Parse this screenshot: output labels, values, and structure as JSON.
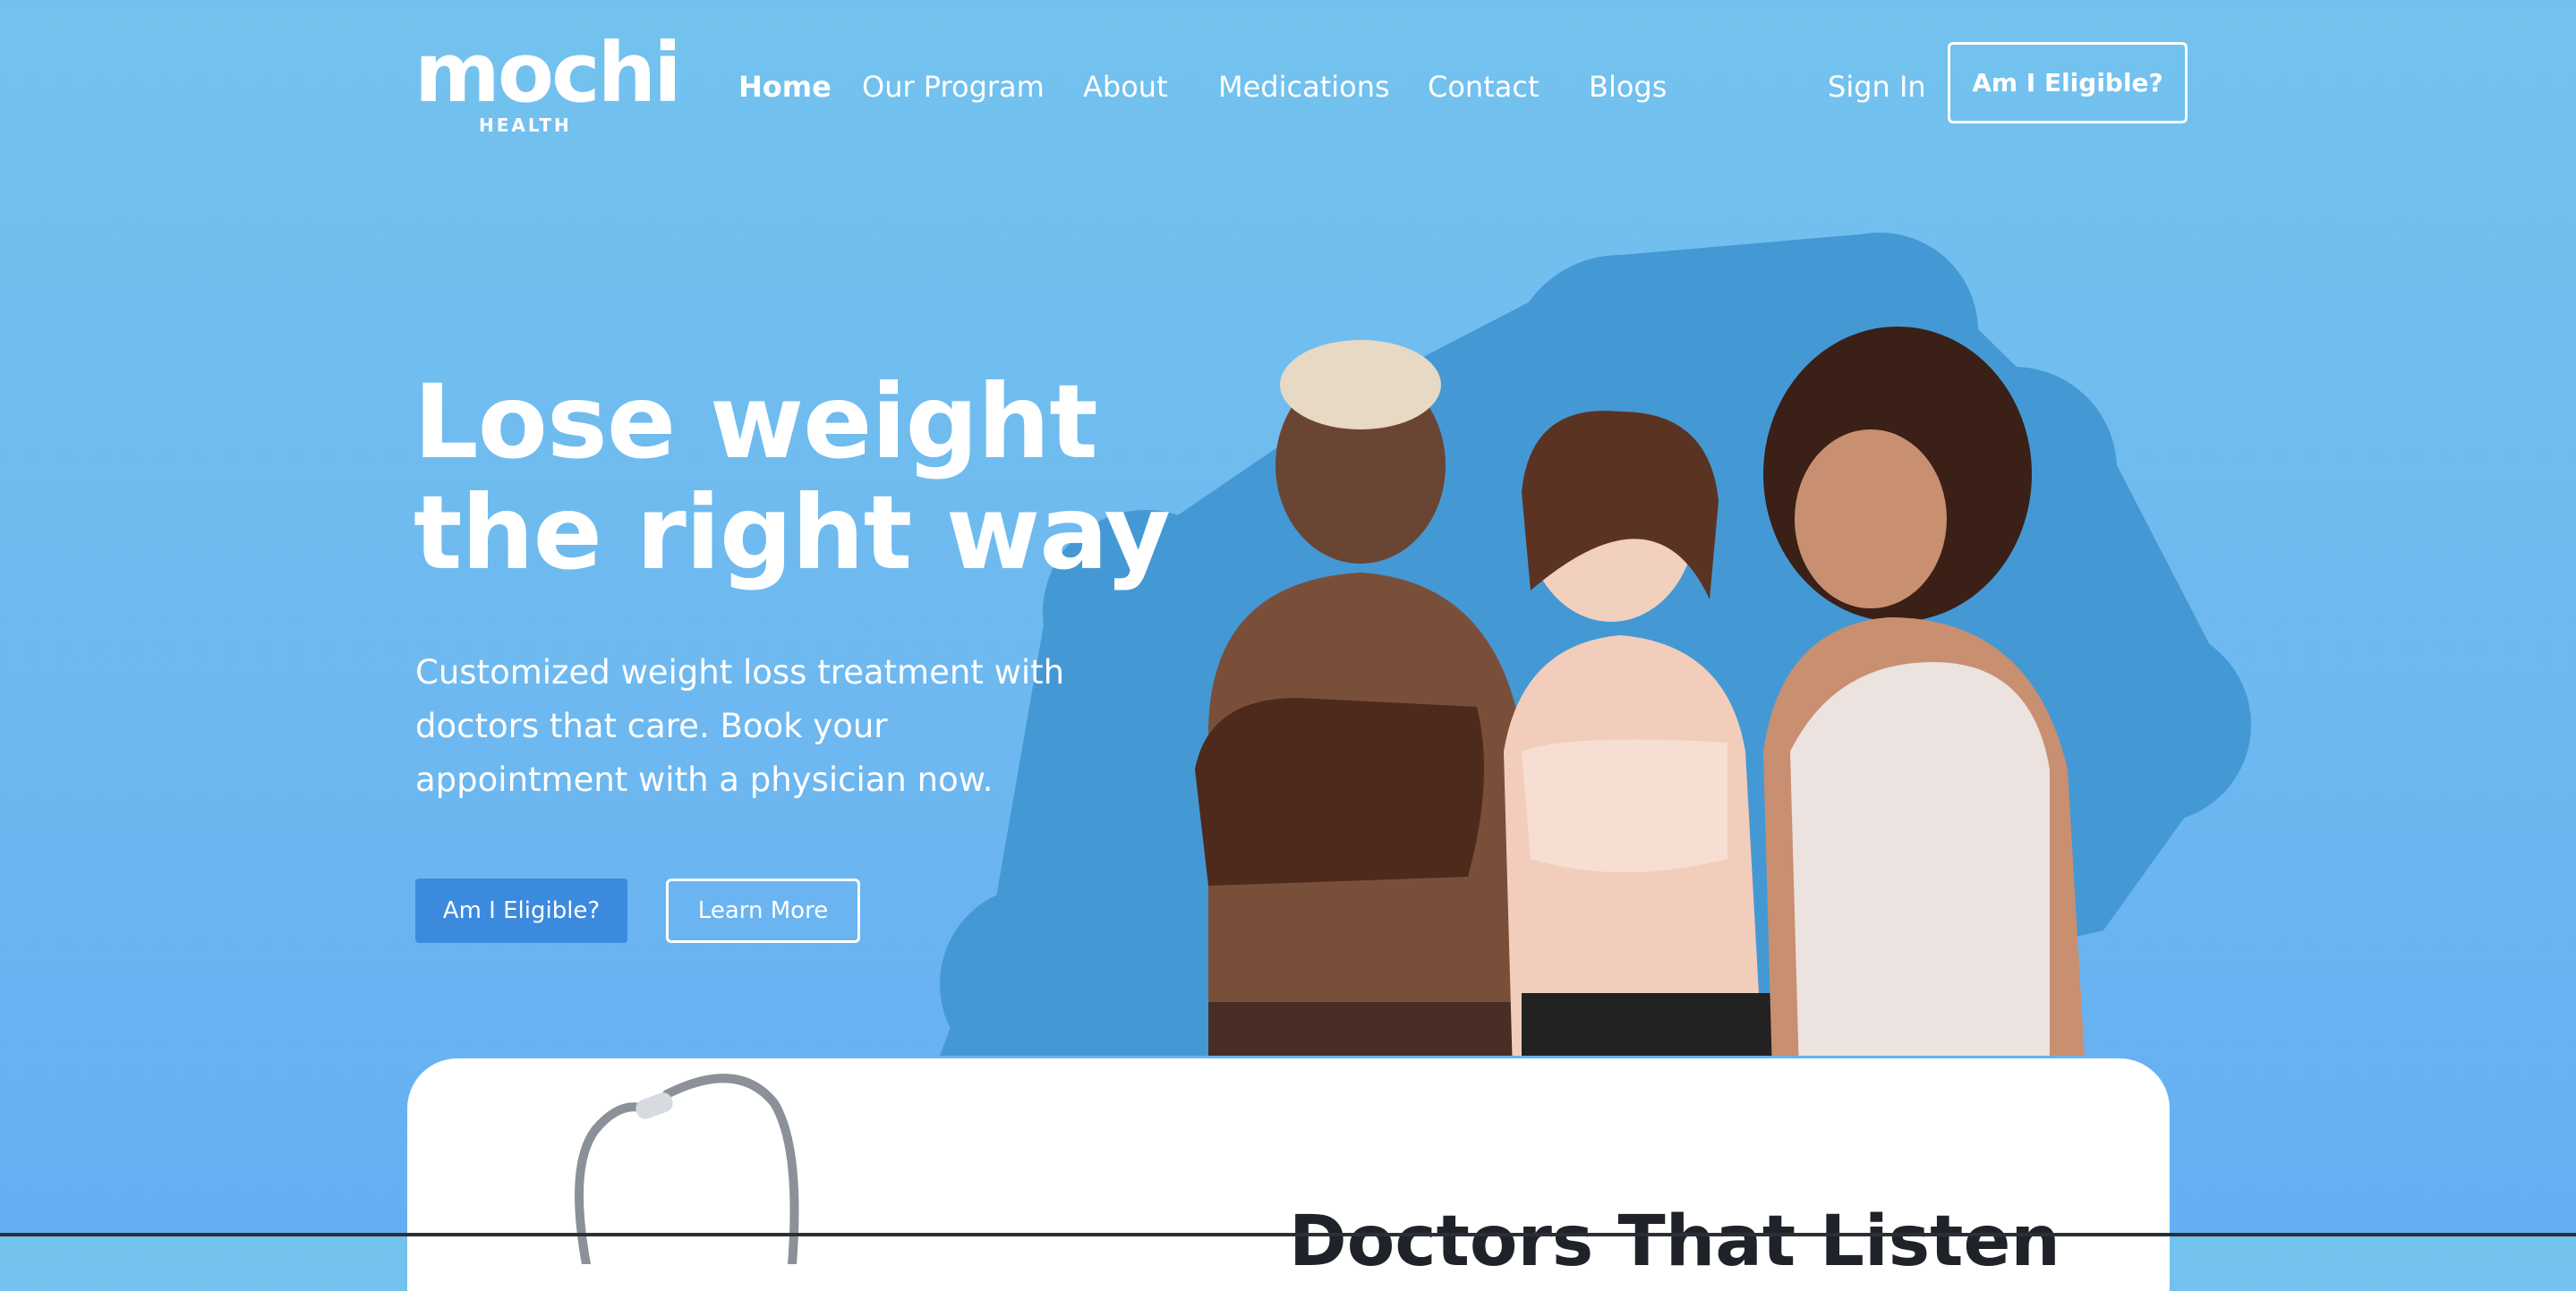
{
  "brand": {
    "name": "mochi",
    "sub": "HEALTH"
  },
  "nav": {
    "items": [
      {
        "label": "Home",
        "active": true
      },
      {
        "label": "Our Program"
      },
      {
        "label": "About"
      },
      {
        "label": "Medications"
      },
      {
        "label": "Contact"
      },
      {
        "label": "Blogs"
      }
    ]
  },
  "header": {
    "sign_in": "Sign In",
    "cta": "Am I Eligible?"
  },
  "hero": {
    "title_line1": "Lose weight",
    "title_line2": "the right way",
    "subtitle": "Customized weight loss treatment with doctors that care. Book your appointment with a physician now.",
    "primary_button": "Am I Eligible?",
    "secondary_button": "Learn More"
  },
  "card": {
    "title": "Doctors That Listen"
  },
  "colors": {
    "background": "#70bdee",
    "blob": "#4499d4",
    "primary_button": "#3b8ade",
    "card": "#ffffff"
  }
}
